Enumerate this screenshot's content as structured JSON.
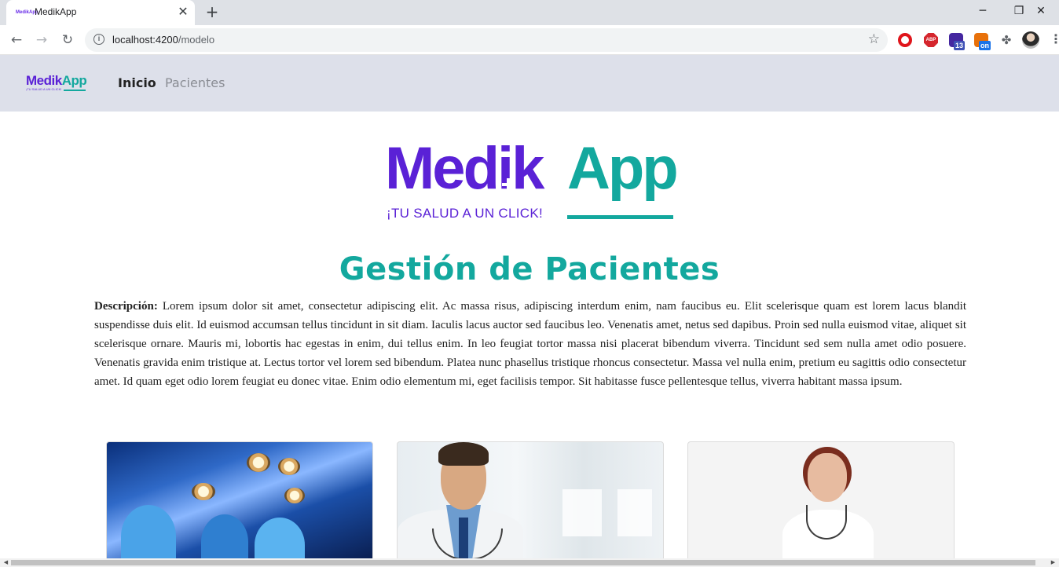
{
  "browser": {
    "tab_title": "MedikApp",
    "favicon_text": "MedikApp",
    "close_glyph": "✕",
    "newtab_glyph": "+",
    "window_controls": {
      "minimize": "─",
      "restore": "❐",
      "close": "✕"
    },
    "url_host": "localhost:4200",
    "url_path": "/modelo",
    "info_glyph": "i",
    "back_glyph": "←",
    "forward_glyph": "→",
    "reload_glyph": "↻",
    "star_glyph": "☆",
    "extensions": {
      "abp_text": "ABP",
      "cap_badge": "13",
      "on_badge": "on",
      "puzzle_glyph": "✤",
      "menu_glyph": "⋮"
    }
  },
  "app": {
    "brand_small": {
      "medik": "Medik",
      "app": "App",
      "tagline": "¡TU SALUD A UN CLICK!"
    },
    "nav": [
      {
        "label": "Inicio",
        "active": true
      },
      {
        "label": "Pacientes",
        "active": false
      }
    ],
    "logo": {
      "medik": "Medik",
      "app": "App",
      "tagline": "¡TU SALUD A UN CLICK!"
    },
    "title": "Gestión de Pacientes",
    "description_label": "Descripción:",
    "description_text": " Lorem ipsum dolor sit amet, consectetur adipiscing elit. Ac massa risus, adipiscing interdum enim, nam faucibus eu. Elit scelerisque quam est lorem lacus blandit suspendisse duis elit. Id euismod accumsan tellus tincidunt in sit diam. Iaculis lacus auctor sed faucibus leo. Venenatis amet, netus sed dapibus. Proin sed nulla euismod vitae, aliquet sit scelerisque ornare. Mauris mi, lobortis hac egestas in enim, dui tellus enim. In leo feugiat tortor massa nisi placerat bibendum viverra. Tincidunt sed sem nulla amet odio posuere. Venenatis gravida enim tristique at. Lectus tortor vel lorem sed bibendum. Platea nunc phasellus tristique rhoncus consectetur. Massa vel nulla enim, pretium eu sagittis odio consectetur amet. Id quam eget odio lorem feugiat eu donec vitae. Enim odio elementum mi, eget facilisis tempor. Sit habitasse fusce pellentesque tellus, viverra habitant massa ipsum."
  },
  "colors": {
    "brand_purple": "#5a21d6",
    "brand_teal": "#13a89e",
    "navbar_bg": "#dde0ea"
  },
  "scrollbar": {
    "left_arrow": "◀",
    "right_arrow": "▶"
  }
}
